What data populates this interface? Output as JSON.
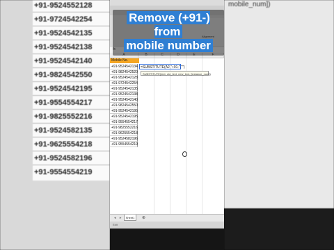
{
  "overlay": {
    "line1": "Remove (+91-) from",
    "line2": "mobile number"
  },
  "background_rows": [
    "+91-9524552128",
    "+91-9724542254",
    "+91-9524542135",
    "+91-9524542138",
    "+91-9524542140",
    "+91-9824542550",
    "+91-9524542195",
    "+91-9554554217",
    "+91-9825552216",
    "+91-9524582135",
    "+91-9625554218",
    "+91-9524582196",
    "+91-9554554219"
  ],
  "right_background": {
    "label": "mobile_num])"
  },
  "ribbon": {
    "label": "Alignment"
  },
  "formula_bar": {
    "label": "fx"
  },
  "sheet": {
    "column_headers": [
      "A",
      "B",
      "C",
      "D",
      "E",
      "F"
    ],
    "header_label": "Mobile No.",
    "mobile_numbers": [
      "+91-9524542134",
      "+91-9824542520",
      "+91-9524542128",
      "+91-9724542254",
      "+91-9524542135",
      "+91-9524542138",
      "+91-9524542140",
      "+91-9824542550",
      "+91-9524542195",
      "+91-9524542195",
      "+91-9554554217",
      "+91-9825552216",
      "+91-9625554218",
      "+91-9524582196",
      "+91-9554554219"
    ],
    "formula_text": "=SUBSTITUTE(A2,\"+91-\",\"\")",
    "tooltip_text": "SUBSTITUTE(text, old_text, new_text, [instance_num])"
  },
  "tabs": {
    "nav": "◂ ▸",
    "sheet_name": "Sheet1",
    "add": "⊕"
  },
  "status": {
    "mode": "Edit"
  }
}
